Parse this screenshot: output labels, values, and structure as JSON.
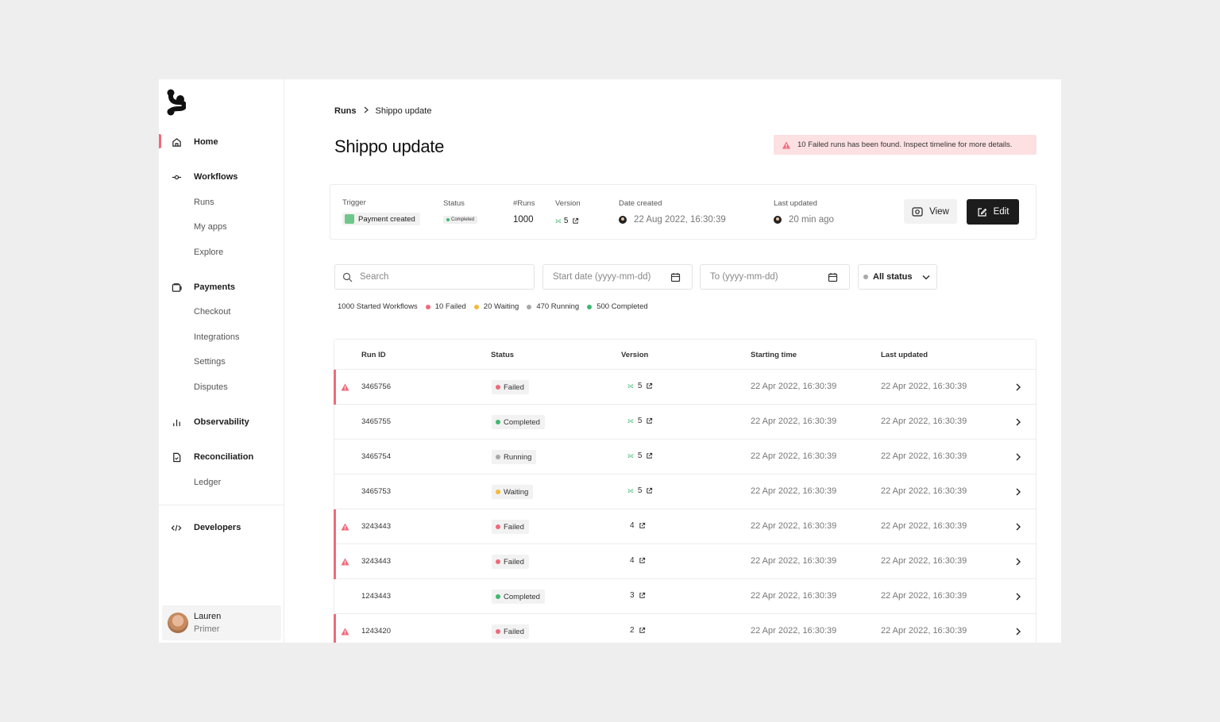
{
  "sidebar": {
    "main_items": [
      {
        "label": "Home",
        "icon": "home-icon"
      },
      {
        "label": "Workflows",
        "icon": "workflow-icon"
      },
      {
        "label": "Payments",
        "icon": "wallet-icon"
      },
      {
        "label": "Observability",
        "icon": "bar-chart-icon"
      },
      {
        "label": "Reconciliation",
        "icon": "document-icon"
      },
      {
        "label": "Developers",
        "icon": "code-icon"
      }
    ],
    "workflow_sub": [
      "Runs",
      "My apps",
      "Explore"
    ],
    "payments_sub": [
      "Checkout",
      "Integrations",
      "Settings",
      "Disputes"
    ],
    "reconciliation_sub": [
      "Ledger"
    ],
    "user": {
      "name": "Lauren",
      "role": "Primer"
    }
  },
  "breadcrumb": {
    "root": "Runs",
    "current": "Shippo update"
  },
  "page_title": "Shippo update",
  "alert": {
    "text": "10 Failed runs has been found. Inspect timeline for more details.",
    "color": "#fde0e2"
  },
  "meta": {
    "trigger_label": "Trigger",
    "trigger_value": "Payment created",
    "status_label": "Status",
    "status_value": "Completed",
    "runs_label": "#Runs",
    "runs_value": "1000",
    "version_label": "Version",
    "version_value": "5",
    "date_created_label": "Date created",
    "date_created_value": "22 Aug 2022, 16:30:39",
    "last_updated_label": "Last updated",
    "last_updated_value": "20 min ago",
    "view_label": "View",
    "edit_label": "Edit"
  },
  "filters": {
    "search_placeholder": "Search",
    "start_placeholder": "Start date (yyyy-mm-dd)",
    "to_placeholder": "To (yyyy-mm-dd)",
    "status_value": "All status"
  },
  "summary": {
    "started": "1000 Started Workflows",
    "failed": "10 Failed",
    "waiting": "20 Waiting",
    "running": "470 Running",
    "completed": "500 Completed"
  },
  "colors": {
    "failed": "#f06a7a",
    "waiting": "#f2b93b",
    "running": "#a8a8a8",
    "completed": "#3fb871"
  },
  "table": {
    "headers": {
      "run_id": "Run ID",
      "status": "Status",
      "version": "Version",
      "starting_time": "Starting time",
      "last_updated": "Last updated"
    },
    "rows": [
      {
        "id": "3465756",
        "status": "Failed",
        "version": "5",
        "git": true,
        "start": "22 Apr 2022, 16:30:39",
        "updated": "22 Apr 2022, 16:30:39"
      },
      {
        "id": "3465755",
        "status": "Completed",
        "version": "5",
        "git": true,
        "start": "22 Apr 2022, 16:30:39",
        "updated": "22 Apr 2022, 16:30:39"
      },
      {
        "id": "3465754",
        "status": "Running",
        "version": "5",
        "git": true,
        "start": "22 Apr 2022, 16:30:39",
        "updated": "22 Apr 2022, 16:30:39"
      },
      {
        "id": "3465753",
        "status": "Waiting",
        "version": "5",
        "git": true,
        "start": "22 Apr 2022, 16:30:39",
        "updated": "22 Apr 2022, 16:30:39"
      },
      {
        "id": "3243443",
        "status": "Failed",
        "version": "4",
        "git": false,
        "start": "22 Apr 2022, 16:30:39",
        "updated": "22 Apr 2022, 16:30:39"
      },
      {
        "id": "3243443",
        "status": "Failed",
        "version": "4",
        "git": false,
        "start": "22 Apr 2022, 16:30:39",
        "updated": "22 Apr 2022, 16:30:39"
      },
      {
        "id": "1243443",
        "status": "Completed",
        "version": "3",
        "git": false,
        "start": "22 Apr 2022, 16:30:39",
        "updated": "22 Apr 2022, 16:30:39"
      },
      {
        "id": "1243420",
        "status": "Failed",
        "version": "2",
        "git": false,
        "start": "22 Apr 2022, 16:30:39",
        "updated": "22 Apr 2022, 16:30:39"
      }
    ]
  }
}
